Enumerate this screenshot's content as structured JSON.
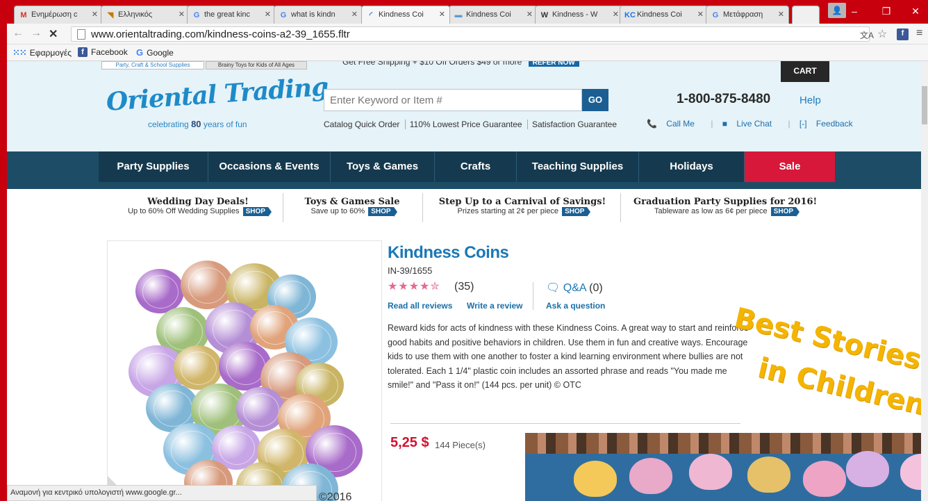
{
  "browser": {
    "tabs": [
      {
        "label": "Ενημέρωση c",
        "icon": "gmail-icon",
        "glyph": "M",
        "color": "#d93025"
      },
      {
        "label": "Ελληνικός",
        "icon": "audio-site-icon",
        "glyph": "◥",
        "color": "#c47a00"
      },
      {
        "label": "the great kinc",
        "icon": "google-icon",
        "glyph": "G",
        "color": "#4285f4"
      },
      {
        "label": "what is kindn",
        "icon": "google-icon",
        "glyph": "G",
        "color": "#4285f4"
      },
      {
        "label": "Kindness Coi",
        "icon": "loading-icon",
        "glyph": "◜",
        "color": "#1a73e8"
      },
      {
        "label": "Kindness Coi",
        "icon": "site-icon",
        "glyph": "▬",
        "color": "#5b9bd5"
      },
      {
        "label": "Kindness - W",
        "icon": "wikipedia-icon",
        "glyph": "W",
        "color": "#333333"
      },
      {
        "label": "Kindness Coi",
        "icon": "kc-icon",
        "glyph": "KC",
        "color": "#1a73e8"
      },
      {
        "label": "Μετάφραση",
        "icon": "translate-icon",
        "glyph": "G",
        "color": "#4285f4"
      }
    ],
    "url": "www.orientaltrading.com/kindness-coins-a2-39_1655.fltr",
    "bookmarks": [
      {
        "label": "Εφαρμογές",
        "icon": "apps-icon"
      },
      {
        "label": "Facebook",
        "icon": "facebook-icon"
      },
      {
        "label": "Google",
        "icon": "google-icon"
      }
    ],
    "status": "Αναμονή για κεντρικό υπολογιστή www.google.gr..."
  },
  "site": {
    "top_tabs": [
      "Party, Craft & School Supplies",
      "Brainy Toys for Kids of All Ages"
    ],
    "ship_message": "Get Free Shipping + $10 Off Orders $49 or more",
    "refer_label": "REFER NOW",
    "cart_label": "CART",
    "logo": {
      "name": "Oriental Trading",
      "tag_pre": "celebrating",
      "tag_num": "80",
      "tag_post": "years of fun"
    },
    "search": {
      "placeholder": "Enter Keyword or Item #",
      "button": "GO"
    },
    "guarantees": [
      "Catalog Quick Order",
      "110% Lowest Price Guarantee",
      "Satisfaction Guarantee"
    ],
    "phone": "1-800-875-8480",
    "help": "Help",
    "contacts": [
      "Call Me",
      "Live Chat",
      "Feedback"
    ],
    "nav": [
      "Party Supplies",
      "Occasions & Events",
      "Toys & Games",
      "Crafts",
      "Teaching Supplies",
      "Holidays",
      "Sale"
    ],
    "promos": [
      {
        "title": "Wedding Day Deals!",
        "sub": "Up to 60% Off Wedding Supplies",
        "shop": "SHOP"
      },
      {
        "title": "Toys & Games Sale",
        "sub": "Save up to 60%",
        "shop": "SHOP"
      },
      {
        "title": "Step Up to a Carnival of Savings!",
        "sub": "Prizes starting at 2¢ per piece",
        "shop": "SHOP"
      },
      {
        "title": "Graduation Party Supplies for 2016!",
        "sub": "Tableware as low as 6¢ per piece",
        "shop": "SHOP"
      }
    ]
  },
  "product": {
    "title": "Kindness Coins",
    "code": "IN-39/1655",
    "rating": 4.5,
    "stars": "★★★★✮",
    "reviews_count": "(35)",
    "qa_label": "Q&A",
    "qa_count": "(0)",
    "links": [
      "Read all reviews",
      "Write a review",
      "Ask a question"
    ],
    "description": "Reward kids for acts of kindness with these Kindness Coins. A great way to start and reinforce good habits and positive behaviors in children. Use them in fun and creative ways. Encourage kids to use them with one another to foster a kind learning environment where bullies are not tolerated. Each 1 1/4\" plastic coin includes an assorted phrase and reads \"You made me smile!\" and \"Pass it on!\" (144 pcs. per unit) © OTC",
    "price": "5,25 $",
    "pieces": "144 Piece(s)"
  },
  "overlay": {
    "line1": "Best Stories",
    "line2": "in Children",
    "copyright": "©2016"
  },
  "colors": {
    "frame": "#c8000e",
    "brand_blue": "#1a78b8",
    "nav_dark": "#153a4f",
    "sale_red": "#d7183a",
    "overlay_yellow": "#f4b400"
  }
}
